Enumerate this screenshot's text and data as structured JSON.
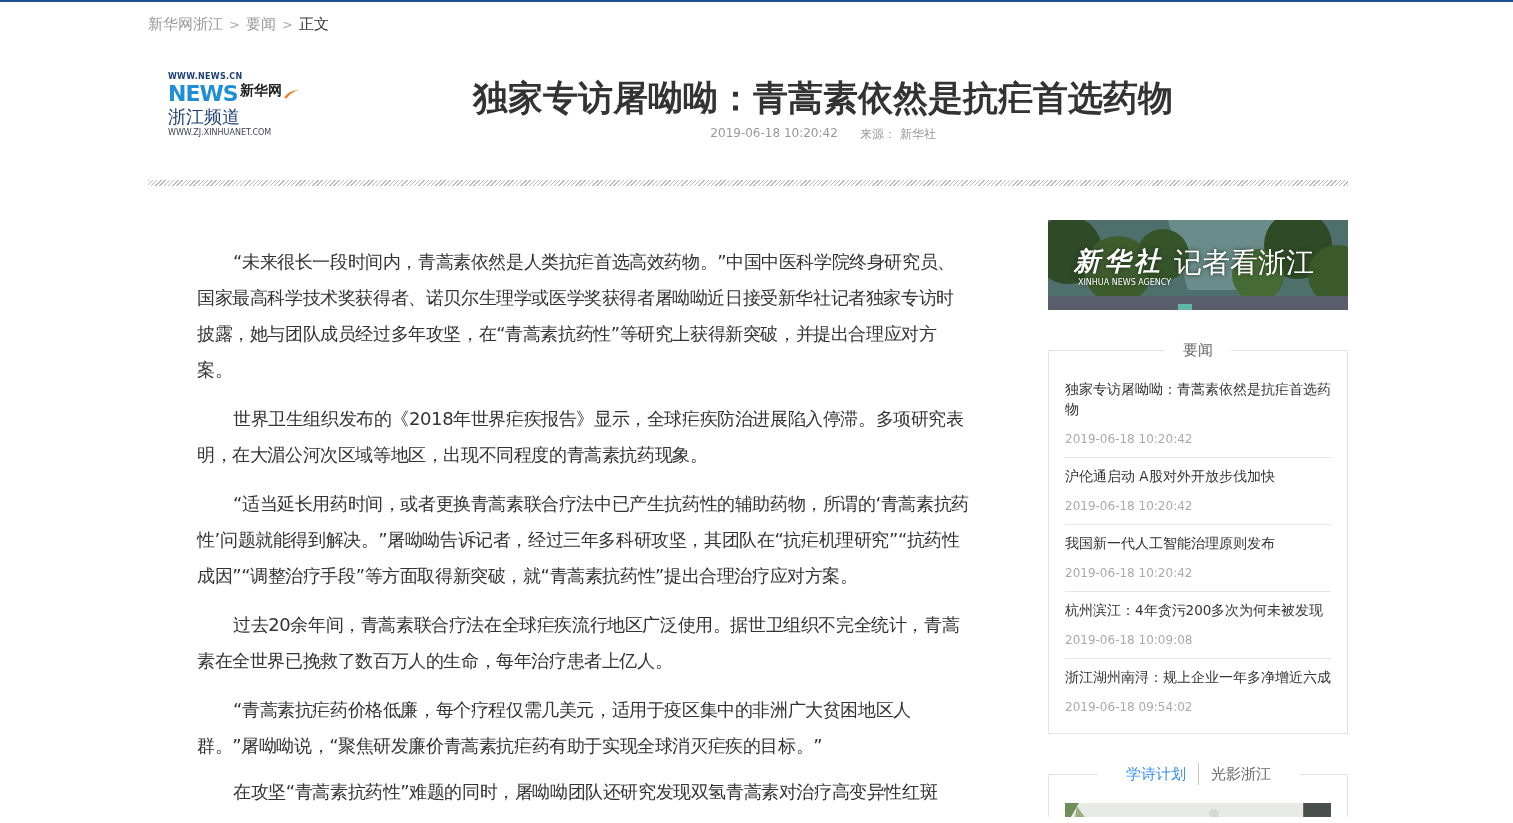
{
  "breadcrumb": {
    "separator": ">",
    "items": [
      {
        "label": "新华网浙江",
        "current": false
      },
      {
        "label": "要闻",
        "current": false
      },
      {
        "label": "正文",
        "current": true
      }
    ]
  },
  "logo": {
    "url_top": "WWW.NEWS.CN",
    "letters": "NEWS",
    "brand": "新华网",
    "channel": "浙江频道",
    "url_bottom": "WWW.ZJ.XINHUANET.COM"
  },
  "article": {
    "title": "独家专访屠呦呦：青蒿素依然是抗疟首选药物",
    "date": "2019-06-18 10:20:42",
    "source": "来源： 新华社",
    "paragraphs": [
      "“未来很长一段时间内，青蒿素依然是人类抗疟首选高效药物。”中国中医科学院终身研究员、国家最高科学技术奖获得者、诺贝尔生理学或医学奖获得者屠呦呦近日接受新华社记者独家专访时披露，她与团队成员经过多年攻坚，在“青蒿素抗药性”等研究上获得新突破，并提出合理应对方案。",
      "世界卫生组织发布的《2018年世界疟疾报告》显示，全球疟疾防治进展陷入停滞。多项研究表明，在大湄公河次区域等地区，出现不同程度的青蒿素抗药现象。",
      "“适当延长用药时间，或者更换青蒿素联合疗法中已产生抗药性的辅助药物，所谓的‘青蒿素抗药性’问题就能得到解决。”屠呦呦告诉记者，经过三年多科研攻坚，其团队在“抗疟机理研究”“抗药性成因”“调整治疗手段”等方面取得新突破，就“青蒿素抗药性”提出合理治疗应对方案。",
      "过去20余年间，青蒿素联合疗法在全球疟疾流行地区广泛使用。据世卫组织不完全统计，青蒿素在全世界已挽救了数百万人的生命，每年治疗患者上亿人。",
      "“青蒿素抗疟药价格低廉，每个疗程仅需几美元，适用于疫区集中的非洲广大贫困地区人群。”屠呦呦说，“聚焦研发廉价青蒿素抗疟药有助于实现全球消灭疟疾的目标。”",
      "在攻坚“青蒿素抗药性”难题的同时，屠呦呦团队还研究发现双氢青蒿素对治疗高变异性红斑"
    ]
  },
  "sidebar": {
    "banner": {
      "kind": "picture",
      "brand": "新华社",
      "brand_en": "XINHUA NEWS AGENCY",
      "title": "记者看浙江"
    },
    "news": {
      "heading": "要闻",
      "items": [
        {
          "title": "独家专访屠呦呦：青蒿素依然是抗疟首选药物",
          "date": "2019-06-18 10:20:42"
        },
        {
          "title": "沪伦通启动 A股对外开放步伐加快",
          "date": "2019-06-18 10:20:42"
        },
        {
          "title": "我国新一代人工智能治理原则发布",
          "date": "2019-06-18 10:20:42"
        },
        {
          "title": "杭州滨江：4年贪污200多次为何未被发现",
          "date": "2019-06-18 10:09:08"
        },
        {
          "title": "浙江湖州南浔：规上企业一年多净增近六成",
          "date": "2019-06-18 09:54:02"
        }
      ]
    },
    "tabs": [
      {
        "label": "学诗计划",
        "selected": true
      },
      {
        "label": "光影浙江",
        "selected": false
      }
    ]
  }
}
